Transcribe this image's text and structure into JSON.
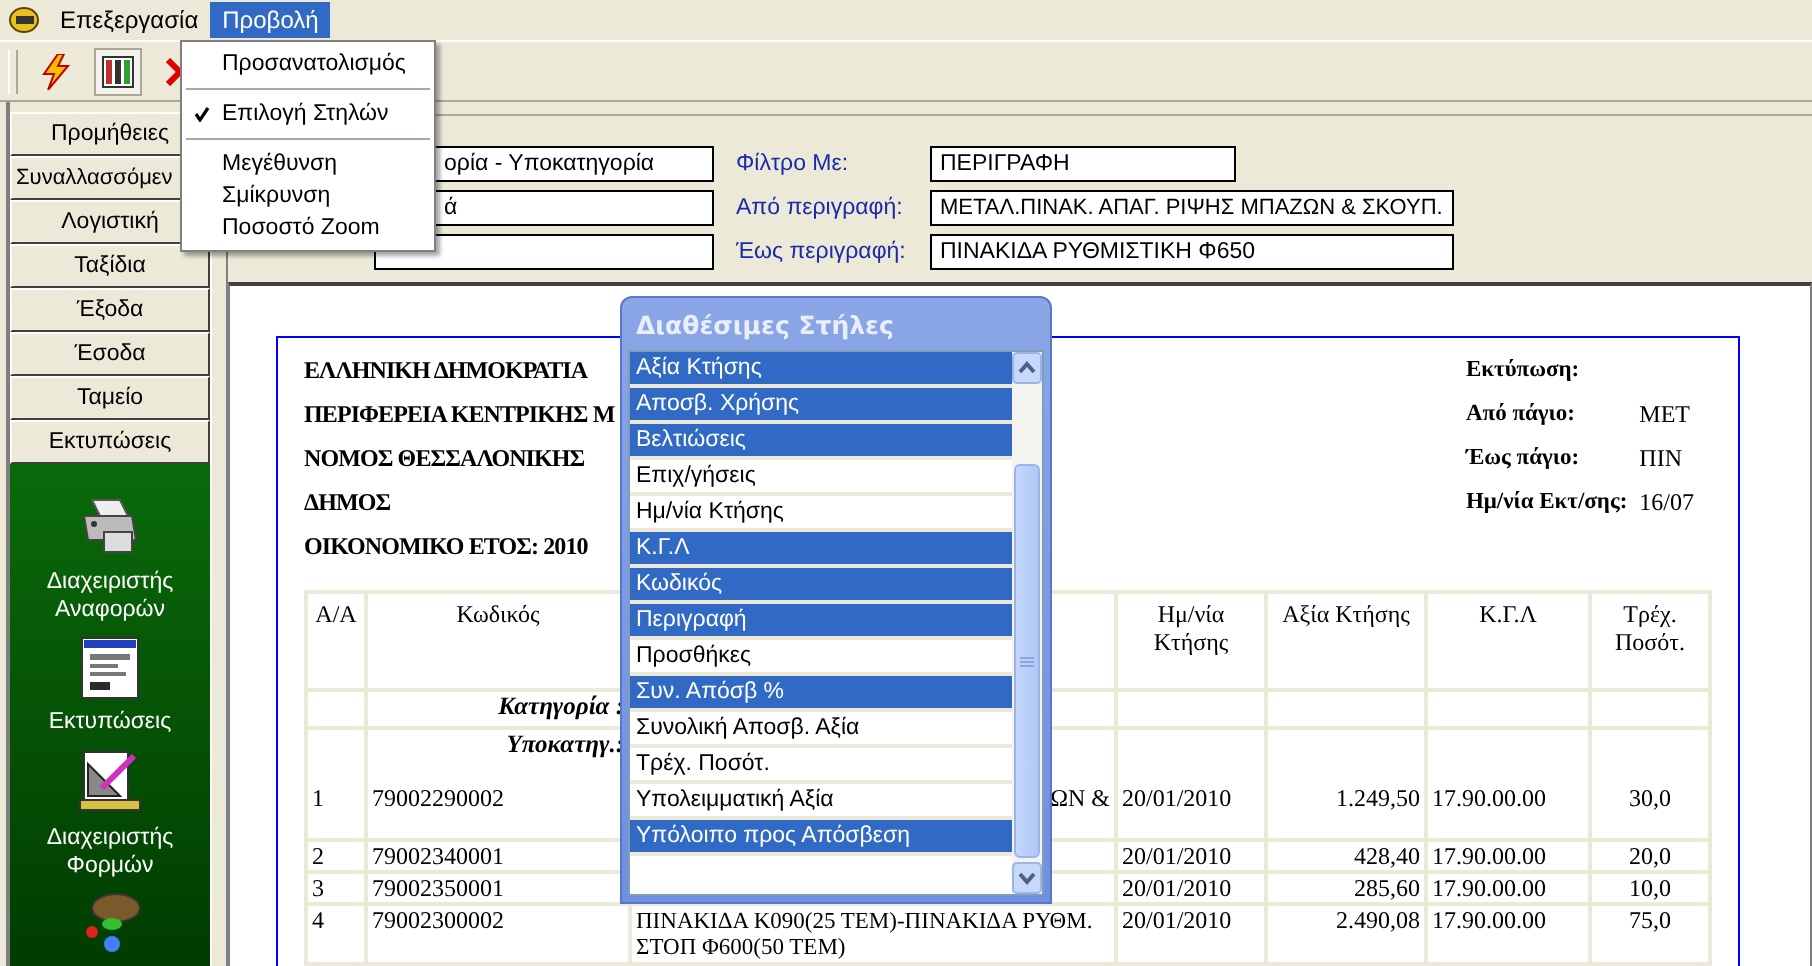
{
  "menubar": [
    {
      "label": "Επεξεργασία",
      "selected": false
    },
    {
      "label": "Προβολή",
      "selected": true
    }
  ],
  "view_menu": [
    {
      "kind": "item",
      "label": "Προσανατολισμός",
      "checked": false
    },
    {
      "kind": "separator"
    },
    {
      "kind": "item",
      "label": "Επιλογή Στηλών",
      "checked": true
    },
    {
      "kind": "separator"
    },
    {
      "kind": "item",
      "label": "Μεγέθυνση",
      "checked": false
    },
    {
      "kind": "item",
      "label": "Σμίκρυνση",
      "checked": false
    },
    {
      "kind": "item",
      "label": "Ποσοστό Zoom",
      "checked": false
    }
  ],
  "sidebar": {
    "buttons": [
      "Προμήθειες",
      "Συναλλασσόμεν",
      "Λογιστική",
      "Ταξίδια",
      "Έξοδα",
      "Έσοδα",
      "Ταμείο",
      "Εκτυπώσεις"
    ],
    "tools": [
      {
        "kind": "printer",
        "label": "Διαχειριστής Αναφορών"
      },
      {
        "kind": "document",
        "label": "Εκτυπώσεις"
      },
      {
        "kind": "setsquare",
        "label": "Διαχειριστής Φορμών"
      },
      {
        "kind": "misc"
      }
    ]
  },
  "filter": {
    "left_fields": [
      {
        "kind": "text",
        "value": "ορία - Υποκατηγορία"
      },
      {
        "kind": "text",
        "value": "ά"
      },
      {
        "kind": "text"
      }
    ],
    "right_fields": [
      {
        "label": "Φίλτρο Με:",
        "value": "ΠΕΡΙΓΡΑΦΗ"
      },
      {
        "label": "Από περιγραφή:",
        "value": "ΜΕΤΑΛ.ΠΙΝΑΚ. ΑΠΑΓ. ΡΙΨΗΣ ΜΠΑΖΩΝ & ΣΚΟΥΠ."
      },
      {
        "label": "Έως περιγραφή:",
        "value": "ΠΙΝΑΚΙΔΑ ΡΥΘΜΙΣΤΙΚΗ Φ650"
      }
    ]
  },
  "report": {
    "header_lines": [
      "ΕΛΛΗΝΙΚΗ ΔΗΜΟΚΡΑΤΙΑ",
      "ΠΕΡΙΦΕΡΕΙΑ ΚΕΝΤΡΙΚΗΣ Μ",
      "ΝΟΜΟΣ ΘΕΣΣΑΛΟΝΙΚΗΣ",
      "ΔΗΜΟΣ",
      "ΟΙΚΟΝΟΜΙΚΟ ΕΤΟΣ: 2010"
    ],
    "print_info": [
      {
        "label": "Εκτύπωση:"
      },
      {
        "label": "Από πάγιο:",
        "value": "ΜΕΤ"
      },
      {
        "label": "Έως πάγιο:",
        "value": "ΠΙΝ"
      },
      {
        "label": "Ημ/νία Εκτ/σης:",
        "value": "16/07"
      }
    ],
    "table": {
      "columns": [
        "Α/Α",
        "Κωδικός",
        "",
        "Ημ/νία Κτήσης",
        "Αξία Κτήσης",
        "Κ.Γ.Λ",
        "Τρέχ. Ποσότ."
      ],
      "rows": [
        {
          "kind": "group",
          "label": "Κατηγορία :"
        },
        {
          "kind": "group",
          "label": "Υποκατηγ.:"
        },
        {
          "kind": "item",
          "cells": [
            "1",
            "79002290002",
            "ΩΝ &",
            "20/01/2010",
            "1.249,50",
            "17.90.00.00",
            "30,0"
          ]
        },
        {
          "kind": "item",
          "cells": [
            "2",
            "79002340001",
            "",
            "20/01/2010",
            "428,40",
            "17.90.00.00",
            "20,0"
          ]
        },
        {
          "kind": "item",
          "cells": [
            "3",
            "79002350001",
            "",
            "20/01/2010",
            "285,60",
            "17.90.00.00",
            "10,0"
          ]
        },
        {
          "kind": "item",
          "cells": [
            "4",
            "79002300002",
            "ΠΙΝΑΚΙΔΑ Κ090(25 ΤΕΜ)-ΠΙΝΑΚΙΔΑ ΡΥΘΜ. ΣΤΟΠ Φ600(50 ΤΕΜ)",
            "20/01/2010",
            "2.490,08",
            "17.90.00.00",
            "75,0"
          ]
        }
      ]
    }
  },
  "columns_popup": {
    "title": "Διαθέσιμες Στήλες",
    "items": [
      {
        "label": "Αξία Κτήσης",
        "selected": true
      },
      {
        "label": "Αποσβ.  Χρήσης",
        "selected": true
      },
      {
        "label": "Βελτιώσεις",
        "selected": true
      },
      {
        "label": "Επιχ/γήσεις",
        "selected": false
      },
      {
        "label": "Ημ/νία Κτήσης",
        "selected": false
      },
      {
        "label": "Κ.Γ.Λ",
        "selected": true
      },
      {
        "label": "Κωδικός",
        "selected": true
      },
      {
        "label": "Περιγραφή",
        "selected": true
      },
      {
        "label": "Προσθήκες",
        "selected": false
      },
      {
        "label": "Συν. Απόσβ %",
        "selected": true
      },
      {
        "label": "Συνολική Αποσβ. Αξία",
        "selected": false
      },
      {
        "label": "Τρέχ. Ποσότ.",
        "selected": false
      },
      {
        "label": "Υπολειμματική Αξία",
        "selected": false
      },
      {
        "label": "Υπόλοιπο προς Απόσβεση",
        "selected": true
      }
    ]
  }
}
